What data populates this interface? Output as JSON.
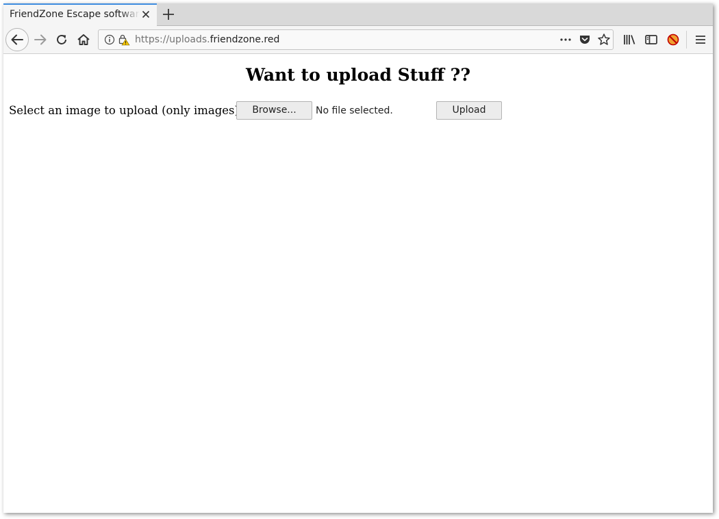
{
  "browser": {
    "tab_title": "FriendZone Escape software",
    "url_prefix": "https://uploads.",
    "url_domain": "friendzone.red",
    "accent_color": "#3d8ce0",
    "icons": [
      "close-icon",
      "plus-icon",
      "back-arrow-icon",
      "forward-arrow-icon",
      "reload-icon",
      "home-icon",
      "info-icon",
      "insecure-lock-icon",
      "more-dots-icon",
      "pocket-icon",
      "star-icon",
      "library-icon",
      "sidebar-icon",
      "extension-icon",
      "hamburger-menu-icon"
    ]
  },
  "page": {
    "heading": "Want to upload Stuff ??",
    "upload_label": "Select an image to upload (only images):",
    "browse_label": "Browse...",
    "file_status": "No file selected.",
    "upload_button": "Upload"
  }
}
